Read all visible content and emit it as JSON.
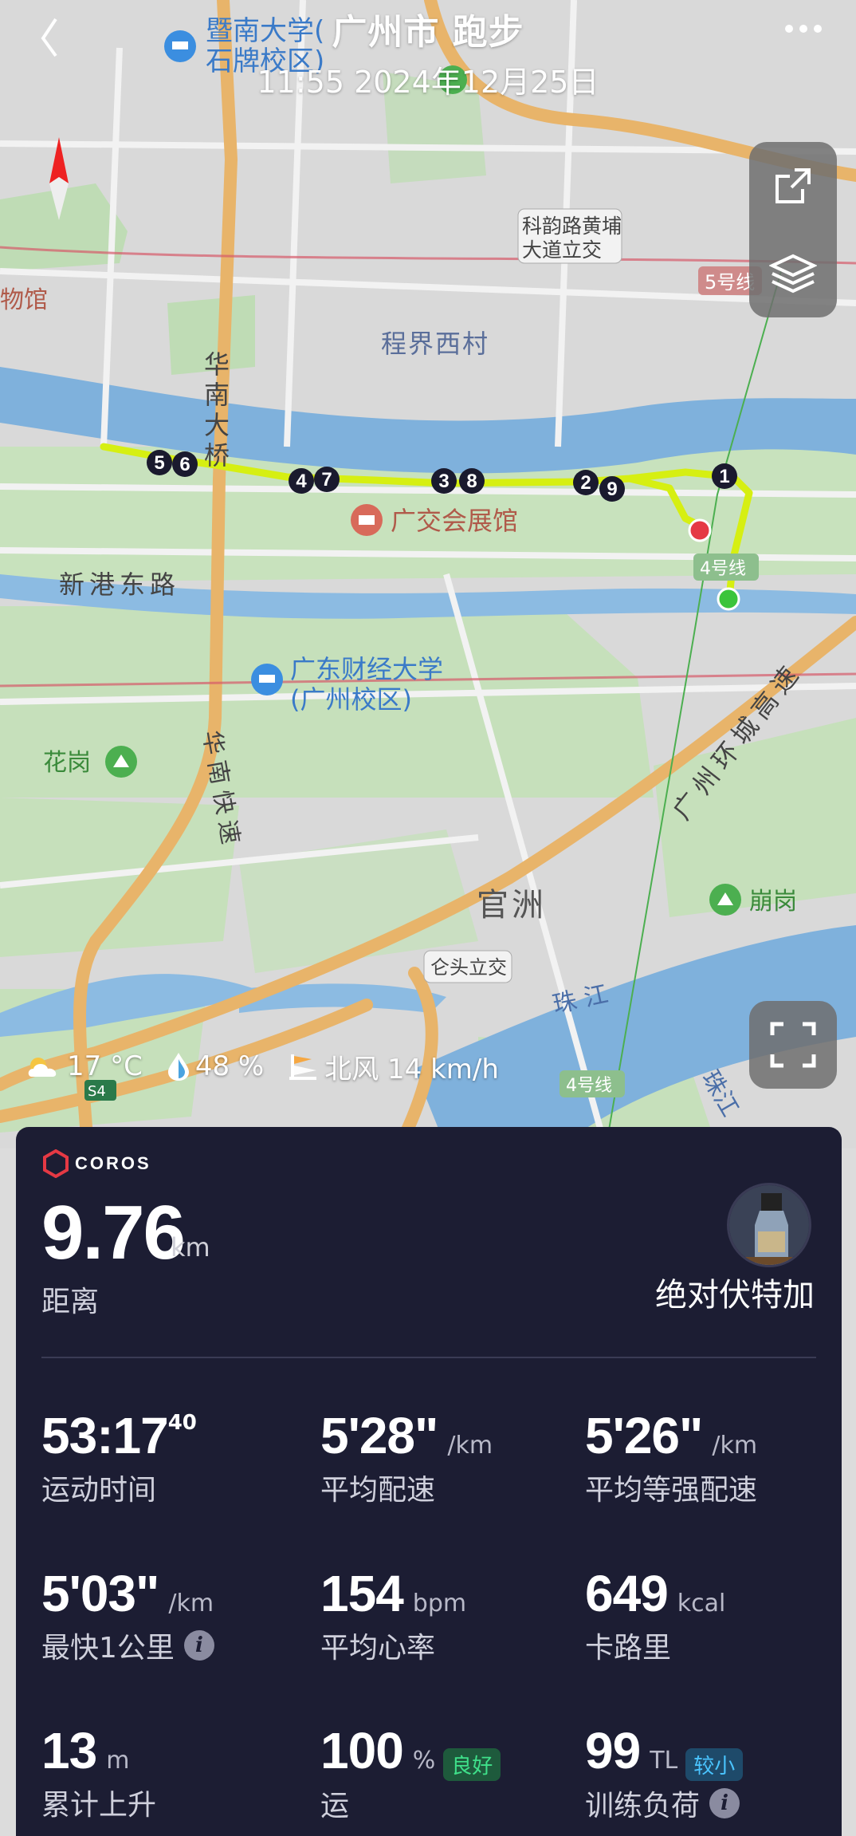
{
  "header": {
    "title": "广州市 跑步",
    "subtitle": "11:55 2024年12月25日"
  },
  "map": {
    "labels": {
      "jnu": "暨南大学(",
      "jnu2": "石牌校区)",
      "keyun": "科韵路黄埔",
      "keyun2": "大道立交",
      "line5": "5号线",
      "museum": "物馆",
      "chengjie": "程界西村",
      "huanan_bridge": "华南大桥",
      "guangjiao": "广交会展馆",
      "xingang": "新港东路",
      "line4a": "4号线",
      "gdufe": "广东财经大学",
      "gdufe2": "(广州校区)",
      "huagang": "花岗",
      "huanan_exp": "华南快速",
      "ring_exp": "广州环城高速",
      "guanzhou": "官洲",
      "bengang": "崩岗",
      "lantou": "仑头立交",
      "zhujiang": "珠江",
      "zhujiang2": "珠江",
      "line4b": "4号线",
      "s4": "S4"
    },
    "km_markers": [
      "1",
      "2",
      "9",
      "3",
      "8",
      "4",
      "7",
      "5",
      "6"
    ]
  },
  "weather": {
    "temp": "17 °C",
    "humidity": "48 %",
    "wind": "北风 14 km/h"
  },
  "card": {
    "brand": "COROS",
    "distance": {
      "value": "9.76",
      "unit": "km",
      "label": "距离"
    },
    "user": "绝对伏特加",
    "stats": {
      "time": {
        "value": "53:17",
        "sup": "40",
        "label": "运动时间"
      },
      "pace": {
        "value": "5'28\"",
        "unit": "/km",
        "label": "平均配速"
      },
      "grade_pace": {
        "value": "5'26\"",
        "unit": "/km",
        "label": "平均等强配速"
      },
      "fast_km": {
        "value": "5'03\"",
        "unit": "/km",
        "label": "最快1公里"
      },
      "hr": {
        "value": "154",
        "unit": "bpm",
        "label": "平均心率"
      },
      "cal": {
        "value": "649",
        "unit": "kcal",
        "label": "卡路里"
      },
      "ascent": {
        "value": "13",
        "unit": "m",
        "label": "累计上升"
      },
      "perf": {
        "value": "100",
        "unit": "%",
        "badge": "良好",
        "label": "运"
      },
      "load": {
        "value": "99",
        "unit": "TL",
        "badge": "较小",
        "label": "训练负荷"
      }
    }
  }
}
